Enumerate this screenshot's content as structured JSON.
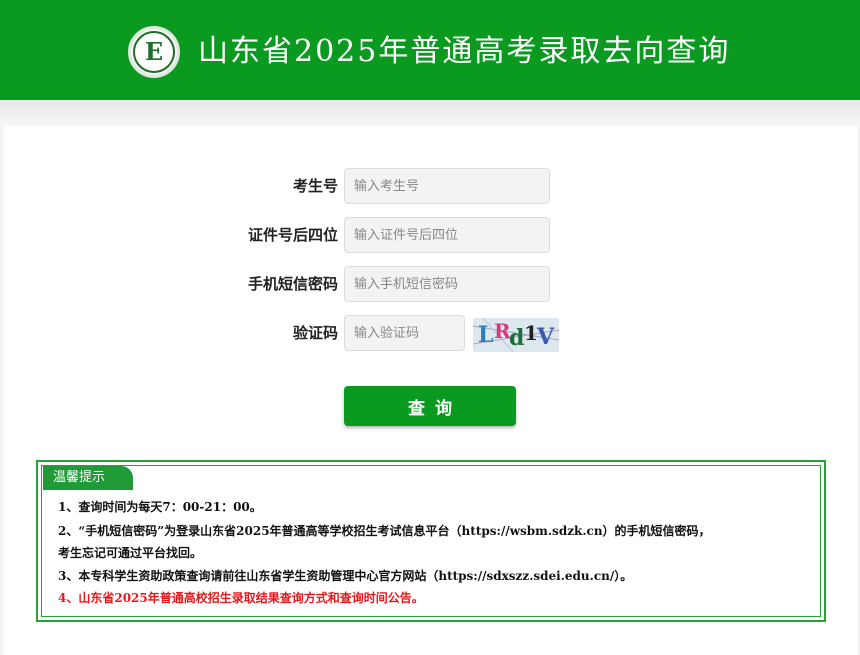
{
  "header": {
    "title": "山东省2025年普通高考录取去向查询",
    "logo_icon": "sdeea-emblem",
    "logo_letter": "E",
    "background_color": "#0b9a20"
  },
  "form": {
    "exam_id": {
      "label": "考生号",
      "placeholder": "输入考生号"
    },
    "id_last4": {
      "label": "证件号后四位",
      "placeholder": "输入证件号后四位"
    },
    "sms_password": {
      "label": "手机短信密码",
      "placeholder": "输入手机短信密码"
    },
    "captcha": {
      "label": "验证码",
      "placeholder": "输入验证码",
      "image_text": [
        "L",
        "R",
        "d",
        "1",
        "V"
      ]
    },
    "submit_label": "查询"
  },
  "notice": {
    "title": "温馨提示",
    "lines": [
      "1、查询时间为每天7：00-21：00。",
      "2、“手机短信密码”为登录山东省2025年普通高等学校招生考试信息平台（https://wsbm.sdzk.cn）的手机短信密码，",
      "考生忘记可通过平台找回。",
      "3、本专科学生资助政策查询请前往山东省学生资助管理中心官方网站（https://sdxszz.sdei.edu.cn/）。",
      "4、山东省2025年普通高校招生录取结果查询方式和查询时间公告。"
    ],
    "highlight_color": "#e5191c"
  }
}
